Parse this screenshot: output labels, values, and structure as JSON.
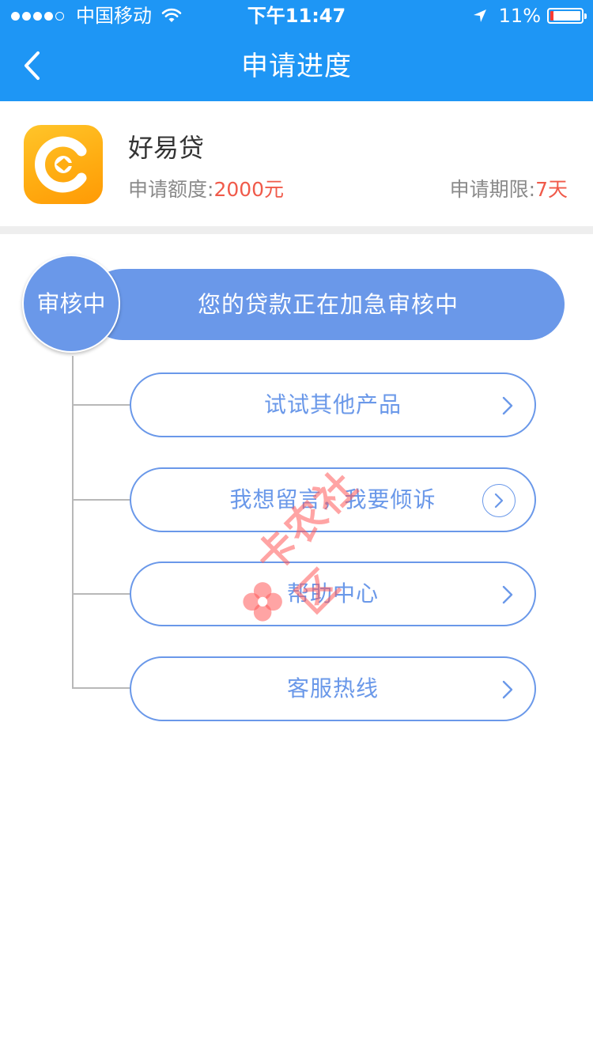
{
  "status_bar": {
    "carrier": "中国移动",
    "time": "下午11:47",
    "battery_pct": "11%",
    "battery_level": 0.11
  },
  "nav": {
    "title": "申请进度",
    "back_icon": "chevron-left-icon"
  },
  "product": {
    "name": "好易贷",
    "amount_label": "申请额度:",
    "amount_value": "2000元",
    "term_label": "申请期限:",
    "term_value": "7天",
    "logo_icon": "haoyidai-logo-icon"
  },
  "progress": {
    "stage": "审核中",
    "message": "您的贷款正在加急审核中"
  },
  "options": [
    {
      "label": "试试其他产品",
      "icon": "chevron-right-icon"
    },
    {
      "label": "我想留言，我要倾诉",
      "icon": "chevron-right-circle-icon"
    },
    {
      "label": "帮助中心",
      "icon": "chevron-right-icon"
    },
    {
      "label": "客服热线",
      "icon": "chevron-right-icon"
    }
  ],
  "watermark": {
    "text": "卡农社区"
  },
  "colors": {
    "header_blue": "#1e96f5",
    "accent_blue": "#6a98e9",
    "highlight_red": "#f05a4a",
    "logo_orange": "#ffad12"
  }
}
